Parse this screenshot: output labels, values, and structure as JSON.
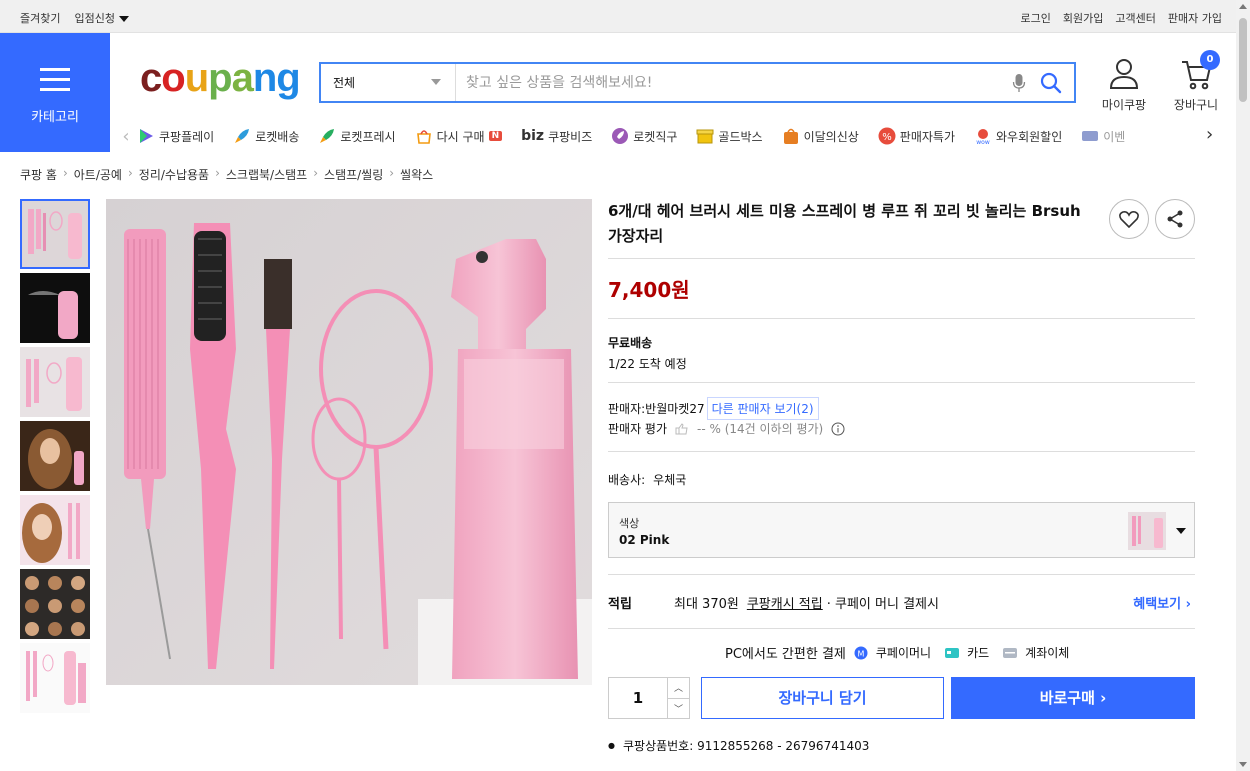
{
  "topbar": {
    "favorites": "즐겨찾기",
    "vendor_apply": "입점신청",
    "login": "로그인",
    "signup": "회원가입",
    "customer_center": "고객센터",
    "seller_signup": "판매자 가입"
  },
  "category": {
    "label": "카테고리"
  },
  "logo": {
    "text": "coupang"
  },
  "search": {
    "category": "전체",
    "placeholder": "찾고 싶은 상품을 검색해보세요!"
  },
  "header": {
    "mypage": "마이쿠팡",
    "cart": "장바구니",
    "cart_count": "0"
  },
  "nav": {
    "items": [
      {
        "label": "쿠팡플레이",
        "icon": "play-icon",
        "color": "#6c5ce7"
      },
      {
        "label": "로켓배송",
        "icon": "rocket-icon",
        "color": "#2d9cdb"
      },
      {
        "label": "로켓프레시",
        "icon": "rocket-fresh-icon",
        "color": "#27ae60"
      },
      {
        "label": "다시 구매",
        "icon": "rebuy-icon",
        "color": "#f39c12",
        "badge": "N"
      },
      {
        "label": "쿠팡비즈",
        "icon": "biz-icon",
        "color": "#111111",
        "prefix": "biz"
      },
      {
        "label": "로켓직구",
        "icon": "rocket-global-icon",
        "color": "#9b59b6"
      },
      {
        "label": "골드박스",
        "icon": "goldbox-icon",
        "color": "#f1c40f"
      },
      {
        "label": "이달의신상",
        "icon": "new-bag-icon",
        "color": "#e67e22"
      },
      {
        "label": "판매자특가",
        "icon": "percent-icon",
        "color": "#e74c3c"
      },
      {
        "label": "와우회원할인",
        "icon": "wow-icon",
        "color": "#e74c3c"
      },
      {
        "label": "이벤",
        "icon": "event-icon",
        "color": "#8e9ccf"
      }
    ]
  },
  "breadcrumb": [
    "쿠팡 홈",
    "아트/공예",
    "정리/수납용품",
    "스크랩북/스탬프",
    "스탬프/씰링",
    "씰왁스"
  ],
  "product": {
    "title": "6개/대 헤어 브러시 세트 미용 스프레이 병 루프 쥐 꼬리 빗 놀리는 Brsuh 가장자리",
    "price": "7,400원",
    "shipping_label": "무료배송",
    "arrival": "1/22 도착 예정",
    "seller_label": "판매자:",
    "seller_name": "반월마켓27",
    "other_sellers": "다른 판매자 보기(2)",
    "seller_rating_label": "판매자 평가",
    "seller_rating_value": "-- % (14건 이하의 평가)",
    "carrier_label": "배송사:",
    "carrier": "우체국",
    "option_label": "색상",
    "option_value": "02 Pink",
    "reward_label": "적립",
    "reward_prefix": "최대 370원",
    "reward_link": "쿠팡캐시 적립",
    "reward_suffix": "· 쿠페이 머니 결제시",
    "benefit_link": "혜택보기 ›",
    "pay_label": "PC에서도 간편한 결제",
    "pay_methods": [
      "쿠페이머니",
      "카드",
      "계좌이체"
    ],
    "quantity": "1",
    "add_to_cart": "장바구니 담기",
    "buy_now": "바로구매 ›",
    "product_number": "쿠팡상품번호: 9112855268 - 26796741403"
  },
  "colors": {
    "accent": "#346aff",
    "price": "#ae0000",
    "product_pink": "#f2a8c6"
  }
}
